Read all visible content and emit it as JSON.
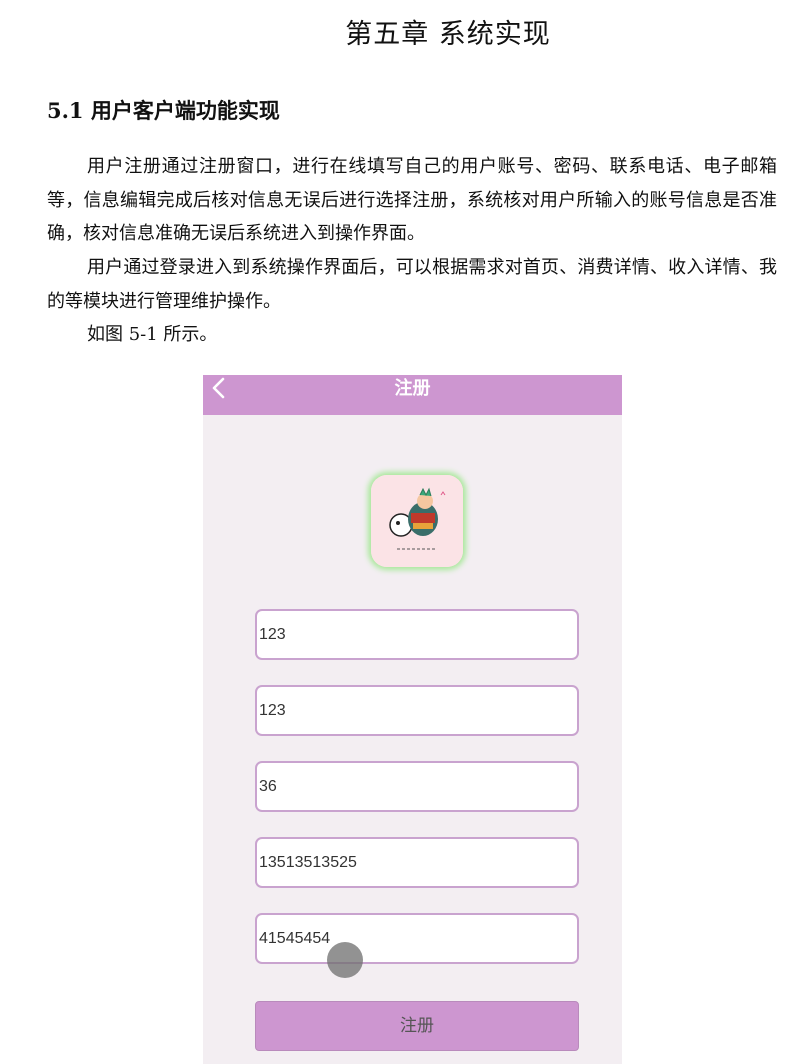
{
  "document": {
    "chapter_title": "第五章  系统实现",
    "section_title": "5.1 用户客户端功能实现",
    "paragraphs": [
      "用户注册通过注册窗口，进行在线填写自己的用户账号、密码、联系电话、电子邮箱等，信息编辑完成后核对信息无误后进行选择注册，系统核对用户所输入的账号信息是否准确，核对信息准确无误后系统进入到操作界面。",
      "用户通过登录进入到系统操作界面后，可以根据需求对首页、消费详情、收入详情、我的等模块进行管理维护操作。",
      "如图 5-1 所示。"
    ]
  },
  "phone": {
    "title": "注册",
    "back_icon": "chevron-left-icon",
    "avatar_icon": "cartoon-avatar-image",
    "fields": [
      {
        "value": "123"
      },
      {
        "value": "123"
      },
      {
        "value": "36"
      },
      {
        "value": "13513513525"
      },
      {
        "value": "41545454"
      }
    ],
    "register_label": "注册",
    "colors": {
      "accent": "#cd96d0",
      "field_border": "#c9a3cf",
      "avatar_glow": "#a8e89a",
      "background": "#f3eef2"
    }
  }
}
